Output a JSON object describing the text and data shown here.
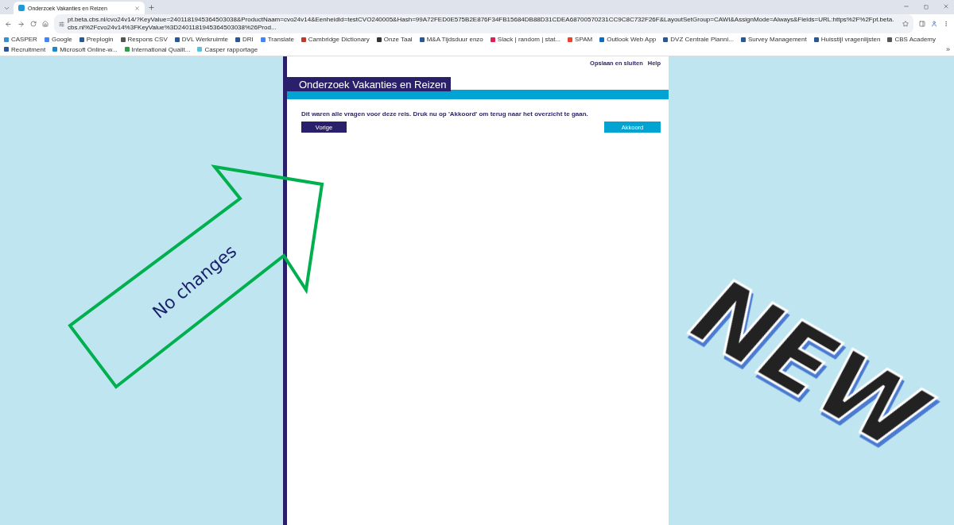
{
  "browser": {
    "tab": {
      "title": "Onderzoek Vakanties en Reizen",
      "selected": true
    },
    "url": "pt.beta.cbs.nl/cvo24v14/?KeyValue=2401181945364503038&ProductNaam=cvo24v14&EenheidId=testCVO240005&Hash=99A72FED0E575B2E876F34FB15684DB88D31CDEA68700570231CC9C8C732F26F&LayoutSetGroup=CAWI&AssignMode=Always&Fields=URL:https%2F%2Fpt.beta.cbs.nl%2Fcvo24v14%3FKeyValue%3D2401181945364503038%26Prod...",
    "bookmarks": [
      {
        "label": "CASPER",
        "color": "#3a8fd0"
      },
      {
        "label": "Google",
        "color": "#4285f4"
      },
      {
        "label": "Preplogin",
        "color": "#2b5797"
      },
      {
        "label": "Respons CSV",
        "color": "#555555"
      },
      {
        "label": "DVL Werkruimte",
        "color": "#2b5797"
      },
      {
        "label": "DRI",
        "color": "#2b5797"
      },
      {
        "label": "Translate",
        "color": "#4285f4"
      },
      {
        "label": "Cambridge Dictionary",
        "color": "#c0392b"
      },
      {
        "label": "Onze Taal",
        "color": "#333333"
      },
      {
        "label": "M&A Tijdsduur enzo",
        "color": "#2b5797"
      },
      {
        "label": "Slack | random | stat...",
        "color": "#e01e5a"
      },
      {
        "label": "SPAM",
        "color": "#e8452c"
      },
      {
        "label": "Outlook Web App",
        "color": "#0f6cbd"
      },
      {
        "label": "DVZ Centrale Planni...",
        "color": "#2b5797"
      },
      {
        "label": "Survey Management",
        "color": "#2b5797"
      },
      {
        "label": "Huisstijl vragenlijsten",
        "color": "#2b5797"
      },
      {
        "label": "CBS Academy",
        "color": "#555555"
      },
      {
        "label": "Recruitment",
        "color": "#2b5797"
      },
      {
        "label": "Microsoft Online-w...",
        "color": "#1e88c8"
      },
      {
        "label": "International Qualit...",
        "color": "#2e9e44"
      },
      {
        "label": "Casper rapportage",
        "color": "#5bc0de"
      }
    ],
    "bookmarks_more": "»"
  },
  "page": {
    "top_links": [
      "Opslaan en sluiten",
      "Help"
    ],
    "title": "Onderzoek Vakanties en Reizen",
    "message": "Dit waren alle vragen voor deze reis. Druk nu op 'Akkoord' om terug naar het overzicht te gaan.",
    "buttons": [
      {
        "label": "Vorige",
        "kind": "back"
      },
      {
        "label": "Akkoord",
        "kind": "confirm"
      }
    ]
  },
  "annotations": [
    {
      "kind": "arrow",
      "text": "No changes"
    },
    {
      "kind": "stamp",
      "text": "NEW"
    }
  ]
}
